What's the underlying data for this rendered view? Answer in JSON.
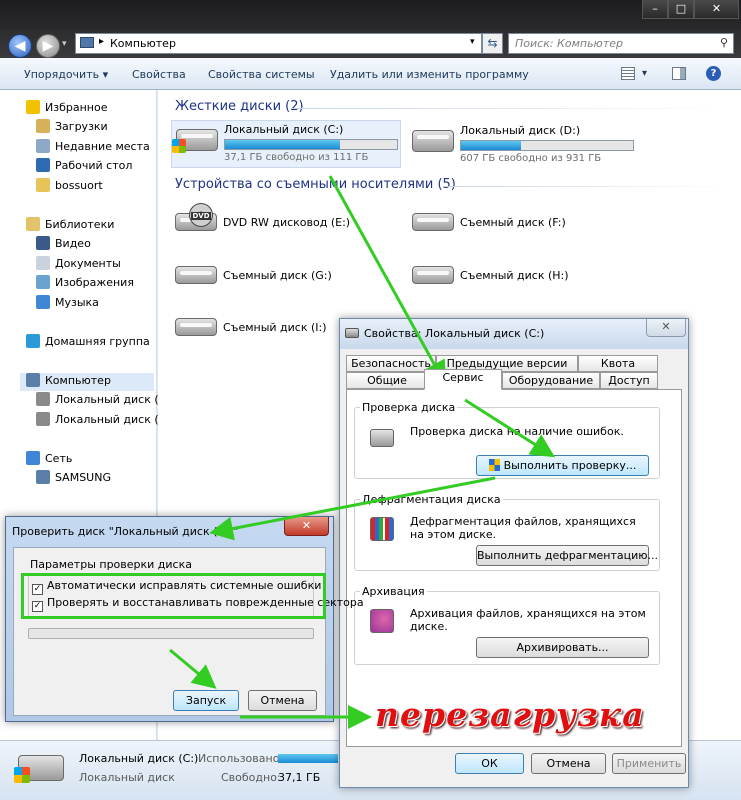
{
  "explorer": {
    "address": "Компьютер",
    "search_placeholder": "Поиск: Компьютер",
    "toolbar": [
      "Упорядочить ▾",
      "Свойства",
      "Свойства системы",
      "Удалить или изменить программу"
    ],
    "sidebar": [
      {
        "label": "Избранное",
        "icon": "star-icon",
        "color": "#f2c200"
      },
      {
        "label": "Загрузки",
        "icon": "downloads-folder-icon",
        "color": "#d7b15a"
      },
      {
        "label": "Недавние места",
        "icon": "recent-places-icon",
        "color": "#8ea8c8"
      },
      {
        "label": "Рабочий стол",
        "icon": "desktop-icon",
        "color": "#2d6bb3"
      },
      {
        "label": "bossuort",
        "icon": "folder-icon",
        "color": "#e6c45a"
      },
      {
        "label": "Библиотеки",
        "icon": "libraries-icon",
        "color": "#e3c36a"
      },
      {
        "label": "Видео",
        "icon": "video-icon",
        "color": "#3a5a8a"
      },
      {
        "label": "Документы",
        "icon": "documents-icon",
        "color": "#c9d3df"
      },
      {
        "label": "Изображения",
        "icon": "pictures-icon",
        "color": "#6aa2d0"
      },
      {
        "label": "Музыка",
        "icon": "music-icon",
        "color": "#3f86d6"
      },
      {
        "label": "Домашняя группа",
        "icon": "homegroup-icon",
        "color": "#2a9ad8"
      },
      {
        "label": "Компьютер",
        "icon": "computer-icon",
        "color": "#5a7ea8"
      },
      {
        "label": "Локальный диск (C",
        "icon": "drive-c-icon",
        "color": "#8a8a8a"
      },
      {
        "label": "Локальный диск (D",
        "icon": "drive-d-icon",
        "color": "#8a8a8a"
      },
      {
        "label": "Сеть",
        "icon": "network-icon",
        "color": "#3f86d6"
      },
      {
        "label": "SAMSUNG",
        "icon": "network-computer-icon",
        "color": "#5a7ea8"
      }
    ],
    "hdd_group": "Жесткие диски (2)",
    "drives": [
      {
        "name": "Локальный диск (C:)",
        "free": "37,1 ГБ свободно из 111 ГБ",
        "used": 0.67
      },
      {
        "name": "Локальный диск (D:)",
        "free": "607 ГБ свободно из 931 ГБ",
        "used": 0.35
      }
    ],
    "removable_group": "Устройства со съемными носителями (5)",
    "removable": [
      "DVD RW дисковод (E:)",
      "Съемный диск (F:)",
      "Съемный диск (G:)",
      "Съемный диск (H:)",
      "Съемный диск (I:)"
    ],
    "status": {
      "name": "Локальный диск (C:)",
      "type": "Локальный диск",
      "used_label": "Использовано:",
      "free_label": "Свободно:",
      "free_value": "37,1 ГБ"
    }
  },
  "props": {
    "title": "Свойства: Локальный диск (C:)",
    "tabs_back": [
      "Безопасность",
      "Предыдущие версии",
      "Квота"
    ],
    "tabs_front": [
      "Общие",
      "Сервис",
      "Оборудование",
      "Доступ"
    ],
    "check": {
      "title": "Проверка диска",
      "text": "Проверка диска на наличие ошибок.",
      "button": "Выполнить проверку..."
    },
    "defrag": {
      "title": "Дефрагментация диска",
      "text": "Дефрагментация файлов, хранящихся на этом диске.",
      "button": "Выполнить дефрагментацию..."
    },
    "backup": {
      "title": "Архивация",
      "text": "Архивация файлов, хранящихся на этом диске.",
      "button": "Архивировать..."
    },
    "ok": "ОК",
    "cancel": "Отмена",
    "apply": "Применить"
  },
  "chkdsk": {
    "title": "Проверить диск \"Локальный диск (C:)\"",
    "group": "Параметры проверки диска",
    "opt1": "Автоматически исправлять системные ошибки",
    "opt2": "Проверять и восстанавливать поврежденные сектора",
    "progress": 0,
    "start": "Запуск",
    "cancel": "Отмена"
  },
  "annotation": "перезагрузка"
}
